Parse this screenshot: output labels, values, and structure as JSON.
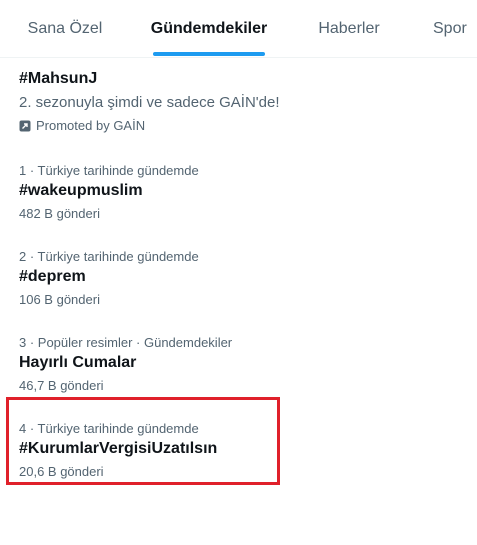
{
  "tabs": [
    {
      "label": "Sana Özel"
    },
    {
      "label": "Gündemdekiler"
    },
    {
      "label": "Haberler"
    },
    {
      "label": "Spor"
    }
  ],
  "promoted": {
    "title": "#MahsunJ",
    "description": "2. sezonuyla şimdi ve sadece GAİN'de!",
    "promoted_by": "Promoted by GAİN",
    "icon": "promoted-icon"
  },
  "trends": [
    {
      "meta": "1 · Türkiye tarihinde gündemde",
      "title": "#wakeupmuslim",
      "count": "482 B gönderi"
    },
    {
      "meta": "2 · Türkiye tarihinde gündemde",
      "title": "#deprem",
      "count": "106 B gönderi"
    },
    {
      "meta": "3 · Popüler resimler · Gündemdekiler",
      "title": "Hayırlı Cumalar",
      "count": "46,7 B gönderi"
    },
    {
      "meta": "4 · Türkiye tarihinde gündemde",
      "title": "#KurumlarVergisiUzatılsın",
      "count": "20,6 B gönderi"
    }
  ],
  "colors": {
    "accent": "#1d9bf0",
    "highlight": "#e0202a",
    "secondary_text": "#536471"
  }
}
